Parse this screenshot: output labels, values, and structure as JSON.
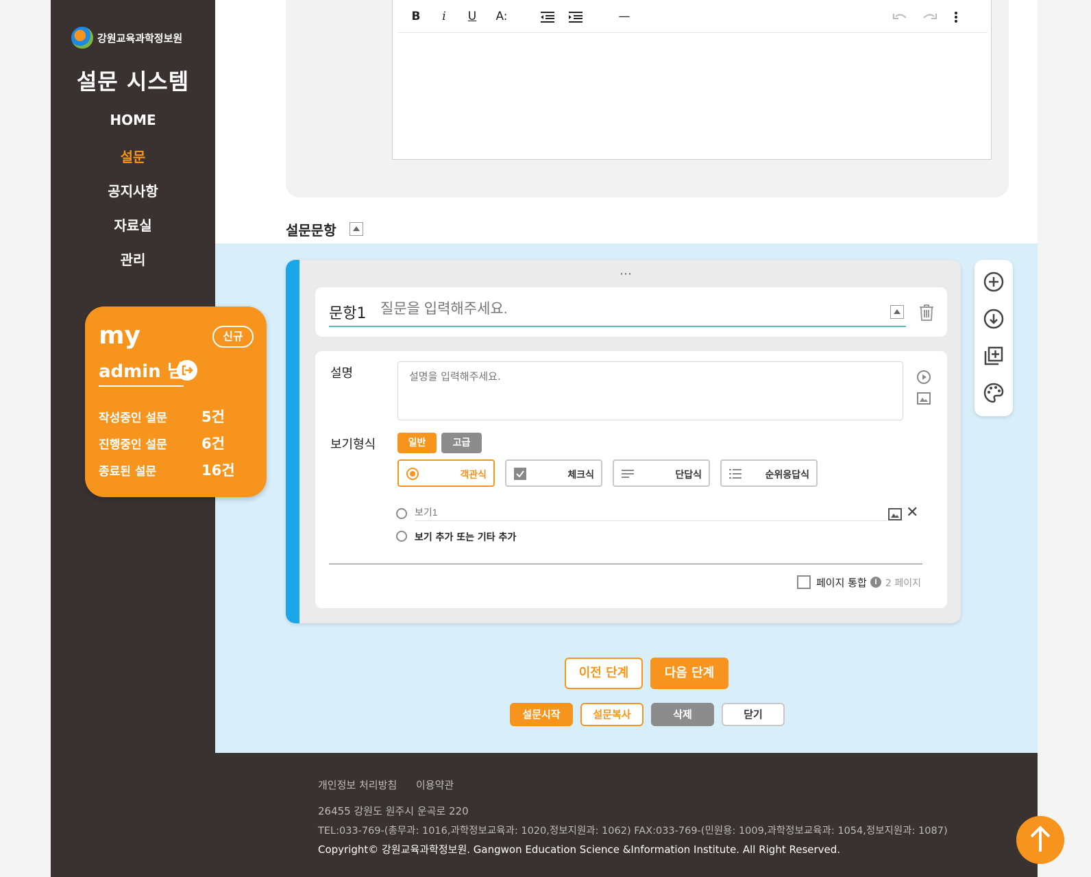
{
  "sidebar": {
    "org_name": "강원교육과학정보원",
    "system_title": "설문 시스템",
    "nav": [
      "HOME",
      "설문",
      "공지사항",
      "자료실",
      "관리"
    ],
    "active_index": 1
  },
  "my_card": {
    "title": "my",
    "new_badge": "신규",
    "user": "admin 님",
    "stats": [
      {
        "label": "작성중인 설문",
        "value": "5건"
      },
      {
        "label": "진행중인 설문",
        "value": "6건"
      },
      {
        "label": "종료된 설문",
        "value": "16건"
      }
    ]
  },
  "editor": {
    "toolbar": {
      "bold": "B",
      "italic": "i",
      "underline": "U",
      "font_size": "A:",
      "divider": "—"
    }
  },
  "section": {
    "title": "설문문항"
  },
  "question": {
    "number": "문항1",
    "placeholder": "질문을 입력해주세요.",
    "drag_handle": "⋯",
    "desc_label": "설명",
    "desc_placeholder": "설명을 입력해주세요.",
    "view_label": "보기형식",
    "modes": [
      "일반",
      "고급"
    ],
    "types": [
      "객관식",
      "체크식",
      "단답식",
      "순위응답식"
    ],
    "option1_placeholder": "보기1",
    "option_add": "보기 추가 또는 기타 추가",
    "merge_label": "페이지 통합",
    "merge_info": "i",
    "merge_page": "2 페이지"
  },
  "buttons": {
    "prev": "이전 단계",
    "next": "다음 단계",
    "start": "설문시작",
    "copy": "설문복사",
    "delete": "삭제",
    "close": "닫기"
  },
  "footer": {
    "privacy": "개인정보 처리방침",
    "terms": "이용약관",
    "address": "26455 강원도 원주시 운곡로 220",
    "tel": "TEL:033-769-(총무과: 1016,과학정보교육과: 1020,정보지원과: 1062) FAX:033-769-(민원용: 1009,과학정보교육과: 1054,정보지원과: 1087)",
    "copyright": "Copyright© 강원교육과학정보원. Gangwon Education Science &Information Institute. All Right Reserved."
  },
  "colors": {
    "accent": "#f7941d",
    "sidebar": "#3a3231",
    "blue_bg": "#d8eef9",
    "question_accent": "#1aa6e8",
    "gray_button": "#8c8c8c"
  }
}
